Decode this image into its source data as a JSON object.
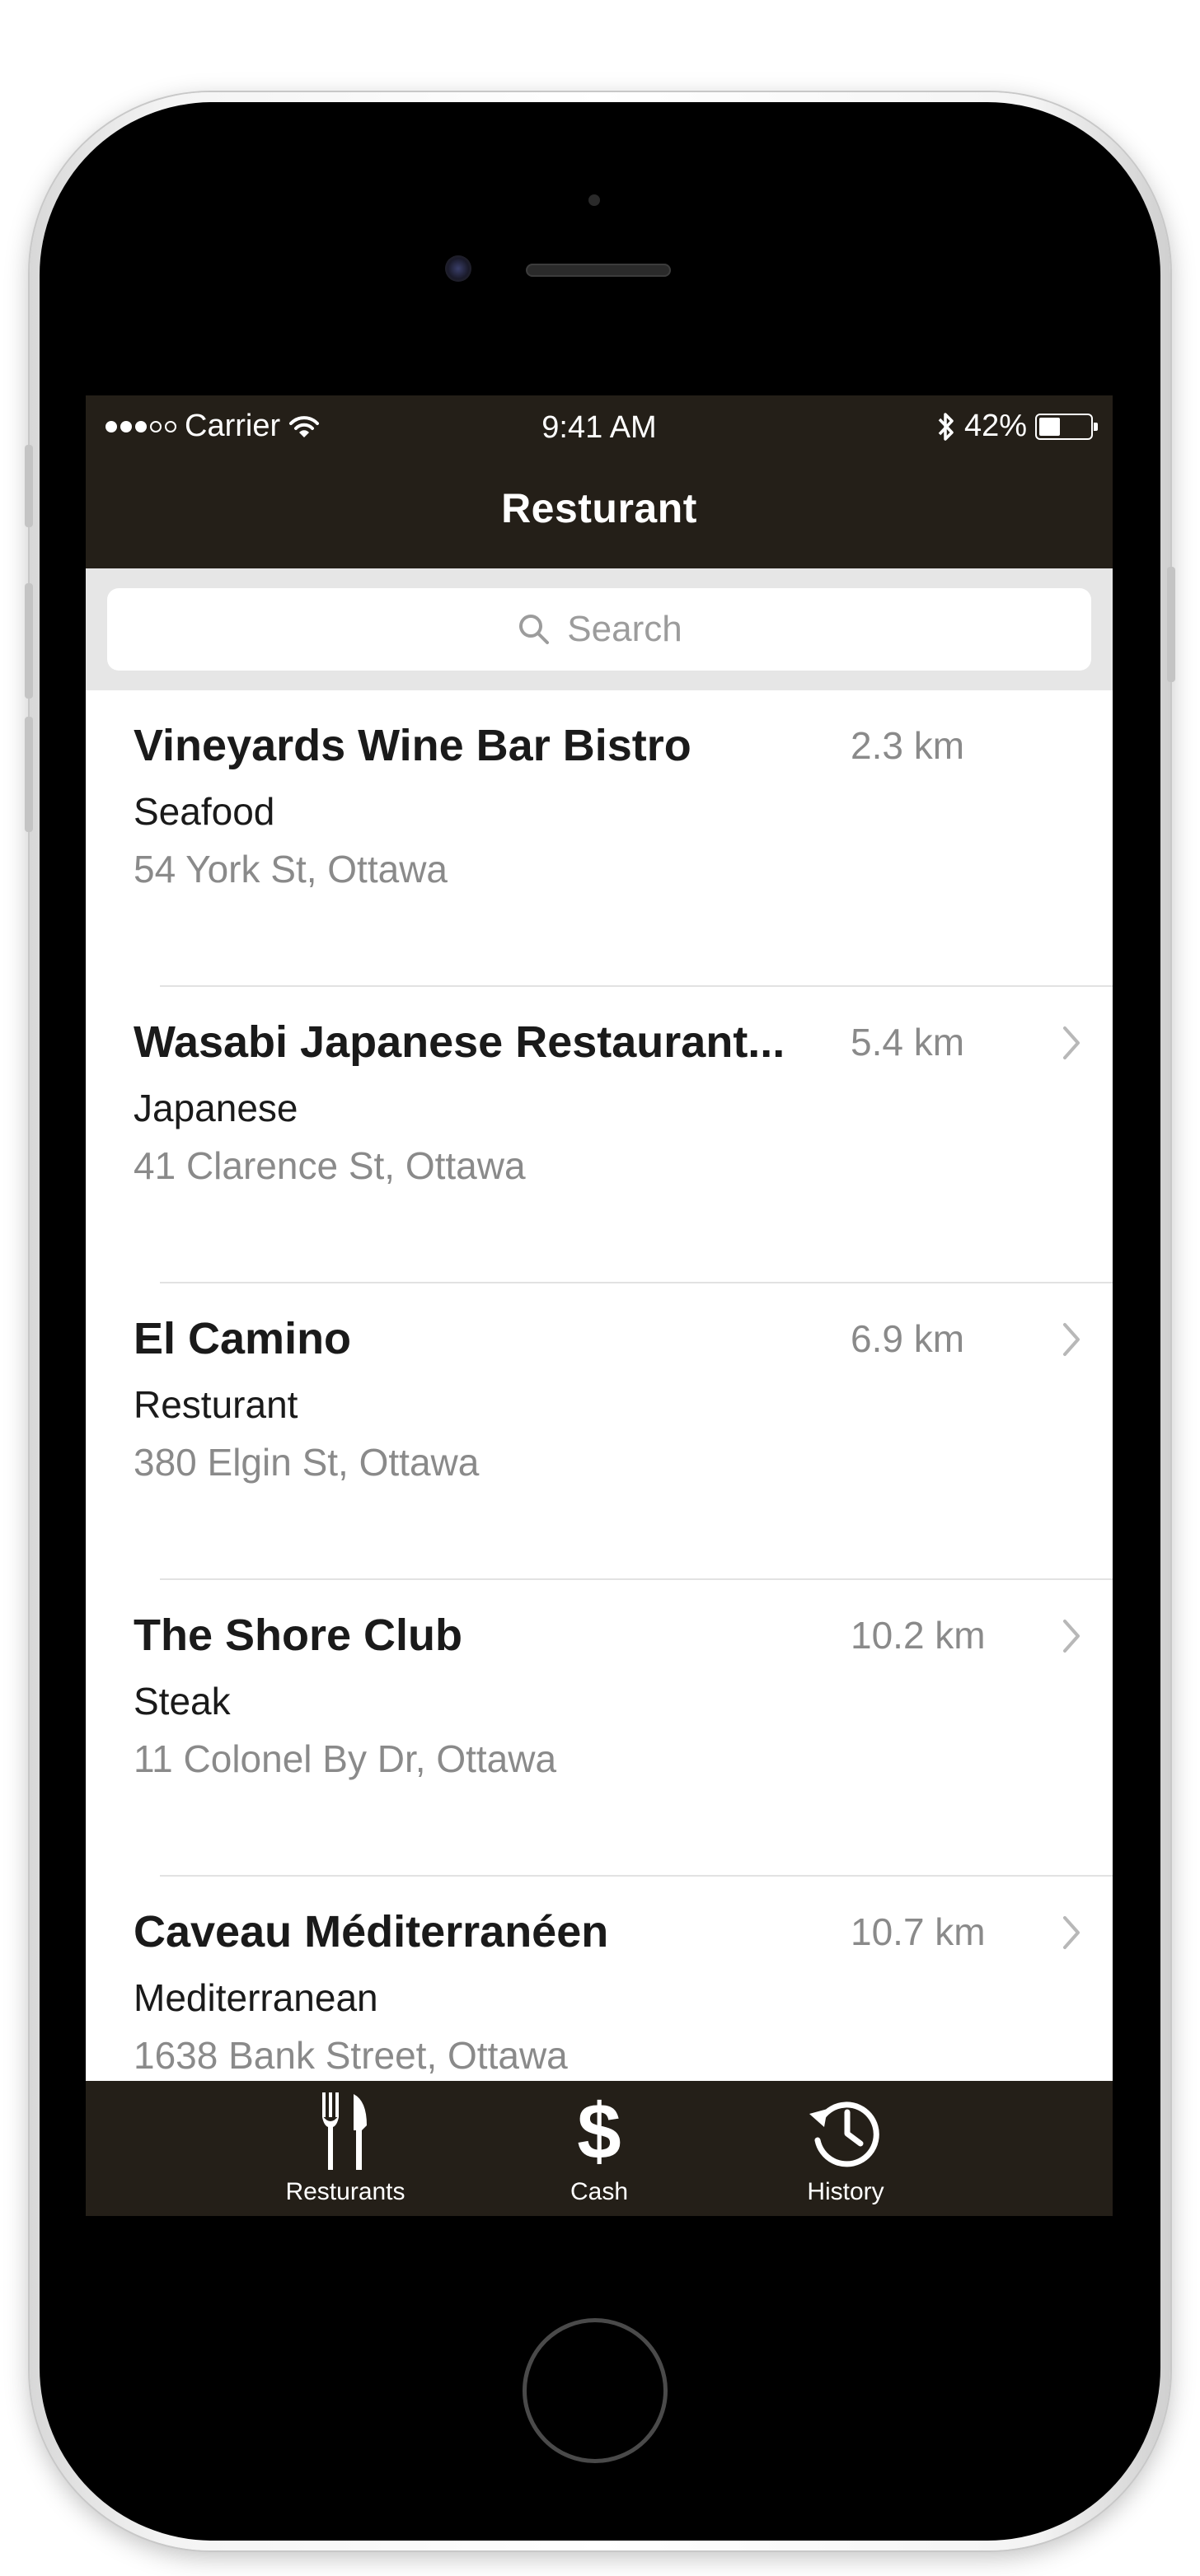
{
  "status_bar": {
    "carrier": "Carrier",
    "time": "9:41 AM",
    "battery": "42%",
    "battery_level": 0.42
  },
  "nav": {
    "title": "Resturant"
  },
  "search": {
    "placeholder": "Search"
  },
  "restaurants": [
    {
      "name": "Vineyards Wine Bar Bistro",
      "category": "Seafood",
      "address": "54 York St, Ottawa",
      "distance": "2.3 km",
      "chevron": false
    },
    {
      "name": "Wasabi Japanese Restaurant...",
      "category": "Japanese",
      "address": "41 Clarence St, Ottawa",
      "distance": "5.4 km",
      "chevron": true
    },
    {
      "name": "El Camino",
      "category": "Resturant",
      "address": "380 Elgin St, Ottawa",
      "distance": "6.9 km",
      "chevron": true
    },
    {
      "name": "The Shore Club",
      "category": "Steak",
      "address": "11 Colonel By Dr, Ottawa",
      "distance": "10.2 km",
      "chevron": true
    },
    {
      "name": "Caveau Méditerranéen",
      "category": "Mediterranean",
      "address": "1638 Bank Street, Ottawa",
      "distance": "10.7 km",
      "chevron": true
    }
  ],
  "tabbar": {
    "tabs": [
      {
        "label": "Resturants",
        "icon": "fork-knife-icon"
      },
      {
        "label": "Cash",
        "icon": "dollar-icon",
        "glyph": "$"
      },
      {
        "label": "History",
        "icon": "history-clock-icon"
      }
    ]
  },
  "colors": {
    "bar_background": "#241f18",
    "search_background": "#e6e6e6",
    "secondary_text": "#8a8a8a"
  }
}
